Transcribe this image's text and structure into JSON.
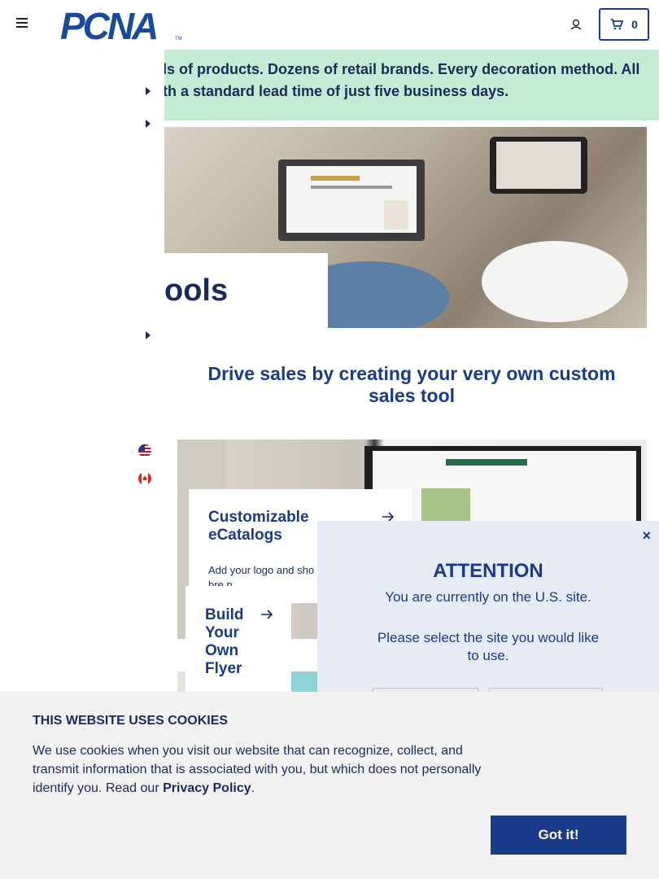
{
  "header": {
    "logo_text": "PCNA",
    "cart_count": "0"
  },
  "banner": {
    "line1": "ls of products. Dozens of retail brands. Every decoration method. All",
    "line2": "th a standard lead time of just five business days."
  },
  "hero": {
    "title": "ools"
  },
  "section": {
    "subheading": "Drive sales by creating your very own custom sales tool"
  },
  "cards": [
    {
      "title": "Customizable eCatalogs",
      "description": "Add your logo and sho customers the full bre                n."
    },
    {
      "title": "Build Your Own Flyer"
    }
  ],
  "modal": {
    "close": "×",
    "title": "ATTENTION",
    "line1": "You are currently on the U.S. site.",
    "line2": "Please select the site you would like to use."
  },
  "cookie": {
    "title": "THIS WEBSITE USES COOKIES",
    "text": "We use cookies when you visit our website that can recognize, collect, and transmit information that is associated with you, but which does not personally identify you. Read our",
    "link": "Privacy Policy",
    "period": ".",
    "button": "Got it!"
  }
}
